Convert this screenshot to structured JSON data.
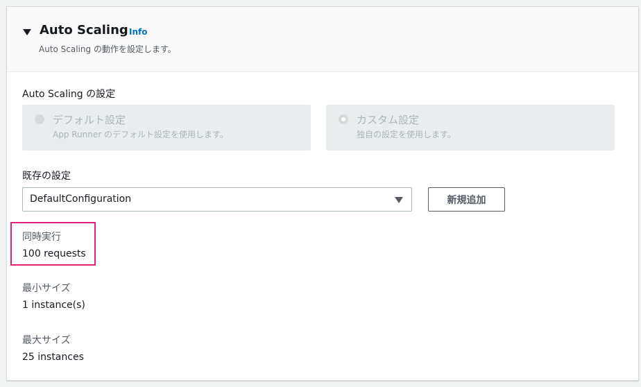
{
  "section": {
    "title": "Auto Scaling",
    "info_link": "Info",
    "description": "Auto Scaling の動作を設定します。"
  },
  "autoscaling_settings": {
    "label": "Auto Scaling の設定",
    "options": [
      {
        "title": "デフォルト設定",
        "description": "App Runner のデフォルト設定を使用します。",
        "selected": false
      },
      {
        "title": "カスタム設定",
        "description": "独自の設定を使用します。",
        "selected": true
      }
    ]
  },
  "existing_config": {
    "label": "既存の設定",
    "selected_value": "DefaultConfiguration",
    "add_new_label": "新規追加"
  },
  "details": {
    "concurrency": {
      "label": "同時実行",
      "value": "100 requests"
    },
    "min_size": {
      "label": "最小サイズ",
      "value": "1 instance(s)"
    },
    "max_size": {
      "label": "最大サイズ",
      "value": "25 instances"
    }
  },
  "colors": {
    "highlight_border": "#e0217a",
    "link": "#0073bb",
    "disabled_tile": "#eaeded"
  },
  "icons": {
    "collapse": "caret-down-icon",
    "select": "chevron-down-icon"
  }
}
